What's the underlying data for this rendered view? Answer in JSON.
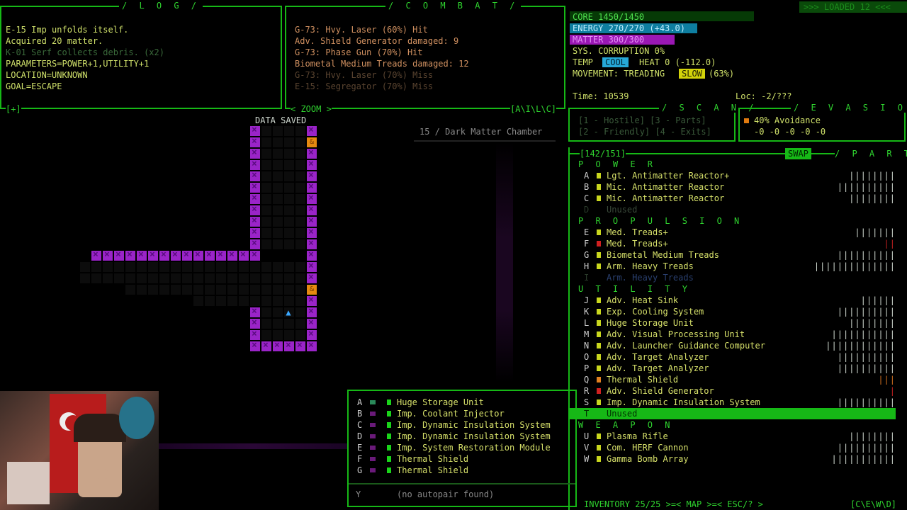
{
  "log": {
    "title": "/ L O G /",
    "lines": [
      "E-15 Imp unfolds itself.",
      "Acquired 20 matter.",
      "K-01 Serf collects debris. (x2)",
      "PARAMETERS=POWER+1,UTILITY+1",
      "LOCATION=UNKNOWN",
      "GOAL=ESCAPE"
    ],
    "corner": "[+]"
  },
  "combat": {
    "title": "/ C O M B A T /",
    "lines": [
      "G-73: Hvy. Laser (60%) Hit",
      " Adv. Shield Generator damaged: 9",
      "G-73: Phase Gun (70%) Hit",
      " Biometal Medium Treads damaged: 12",
      "G-73: Hvy. Laser (70%) Miss",
      "E-15: Segregator (70%) Miss"
    ],
    "zoom": "< ZOOM >",
    "corner": "[A\\I\\L\\C]"
  },
  "status": {
    "core": "CORE   1450/1450",
    "energy": "ENERGY 270/270 (+43.0)",
    "matter": "MATTER 300/300",
    "corruption": "SYS. CORRUPTION 0%",
    "temp_label": "TEMP",
    "temp_value": "COOL",
    "heat": "HEAT 0 (-112.0)",
    "movement_label": "MOVEMENT: TREADING",
    "movement_value": "SLOW",
    "movement_pct": "(63%)",
    "loaded": ">>> LOADED 12 <<<",
    "time": "Time: 10539",
    "loc": "Loc: -2/???"
  },
  "scan": {
    "title": "/ S C A N /",
    "line1": "[1 - Hostile]  [3 - Parts]",
    "line2": "[2 - Friendly] [4 - Exits]"
  },
  "evasion": {
    "title": "/ E V A S I O N /",
    "line1": "40% Avoidance",
    "line2": "-0 -0 -0 -0 -0"
  },
  "map": {
    "data_saved": "DATA SAVED",
    "location": "15 / Dark Matter Chamber"
  },
  "parts": {
    "count": "[142/151]",
    "swap": "SWAP",
    "title": "/ P A R T S /",
    "power_header": "P O W E R",
    "power": [
      {
        "key": "A",
        "name": "Lgt. Antimatter Reactor+",
        "bars": "||||||||",
        "color": "#c9d71e"
      },
      {
        "key": "B",
        "name": "Mic. Antimatter Reactor",
        "bars": "||||||||||",
        "color": "#c9d71e"
      },
      {
        "key": "C",
        "name": "Mic. Antimatter Reactor",
        "bars": "||||||||",
        "color": "#c9d71e"
      },
      {
        "key": "D",
        "name": "Unused",
        "bars": "",
        "color": ""
      }
    ],
    "propulsion_header": "P R O P U L S I O N",
    "propulsion": [
      {
        "key": "E",
        "name": "Med. Treads+",
        "bars": "|||||||",
        "color": "#c9d71e"
      },
      {
        "key": "F",
        "name": "Med. Treads+",
        "bars": "||",
        "color": "#d02020"
      },
      {
        "key": "G",
        "name": "Biometal Medium Treads",
        "bars": "||||||||||",
        "color": "#c9d71e"
      },
      {
        "key": "H",
        "name": "Arm. Heavy Treads",
        "bars": "||||||||||||||",
        "color": "#c9d71e"
      },
      {
        "key": "I",
        "name": "Arm. Heavy Treads",
        "bars": "",
        "color": ""
      }
    ],
    "utility_header": "U T I L I T Y",
    "utility": [
      {
        "key": "J",
        "name": "Adv. Heat Sink",
        "bars": "||||||",
        "color": "#c9d71e"
      },
      {
        "key": "K",
        "name": "Exp. Cooling System",
        "bars": "||||||||||",
        "color": "#c9d71e"
      },
      {
        "key": "L",
        "name": "Huge Storage Unit",
        "bars": "||||||||",
        "color": "#c9d71e"
      },
      {
        "key": "M",
        "name": "Adv. Visual Processing Unit",
        "bars": "|||||||||||",
        "color": "#c9d71e"
      },
      {
        "key": "N",
        "name": "Adv. Launcher Guidance Computer",
        "bars": "||||||||||||",
        "color": "#c9d71e"
      },
      {
        "key": "O",
        "name": "Adv. Target Analyzer",
        "bars": "||||||||||",
        "color": "#c9d71e"
      },
      {
        "key": "P",
        "name": "Adv. Target Analyzer",
        "bars": "||||||||||",
        "color": "#c9d71e"
      },
      {
        "key": "Q",
        "name": "Thermal Shield",
        "bars": "|||",
        "color": "#e08020"
      },
      {
        "key": "R",
        "name": "Adv. Shield Generator",
        "bars": "|",
        "color": "#d02020"
      },
      {
        "key": "S",
        "name": "Imp. Dynamic Insulation System",
        "bars": "||||||||||",
        "color": "#c9d71e"
      },
      {
        "key": "T",
        "name": "Unused",
        "bars": "",
        "color": ""
      }
    ],
    "weapon_header": "W E A P O N",
    "weapon": [
      {
        "key": "U",
        "name": "Plasma Rifle",
        "bars": "||||||||",
        "color": "#c9d71e"
      },
      {
        "key": "V",
        "name": "Com. HERF Cannon",
        "bars": "||||||||||",
        "color": "#c9d71e"
      },
      {
        "key": "W",
        "name": "Gamma Bomb Array",
        "bars": "|||||||||||",
        "color": "#c9d71e"
      }
    ],
    "footer": "INVENTORY 25/25 >=< MAP >=< ESC/? >",
    "footer_right": "[C\\E\\W\\D]"
  },
  "inventory": {
    "items": [
      {
        "key": "A",
        "name": "Huge Storage Unit"
      },
      {
        "key": "B",
        "name": "Imp. Coolant Injector"
      },
      {
        "key": "C",
        "name": "Imp. Dynamic Insulation System"
      },
      {
        "key": "D",
        "name": "Imp. Dynamic Insulation System"
      },
      {
        "key": "E",
        "name": "Imp. System Restoration Module"
      },
      {
        "key": "F",
        "name": "Thermal Shield"
      },
      {
        "key": "G",
        "name": "Thermal Shield"
      }
    ],
    "autopair_key": "Y",
    "autopair": "(no autopair found)"
  }
}
